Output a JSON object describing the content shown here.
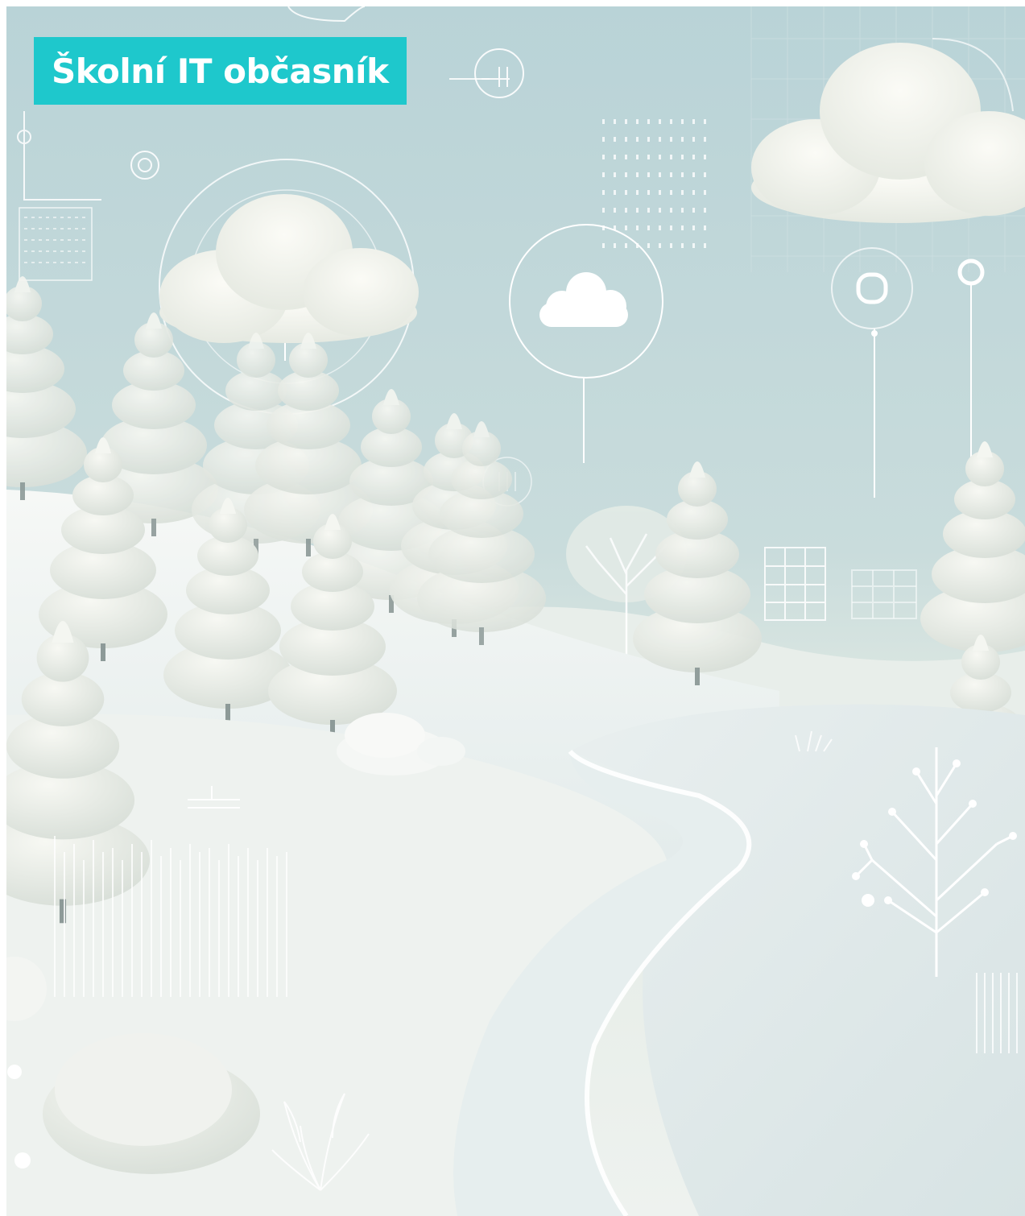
{
  "header": {
    "title": "Školní IT občasník"
  },
  "colors": {
    "title_background": "#1ec8cc",
    "title_text": "#ffffff",
    "sky_top": "#b7d2d6",
    "sky_bottom": "#dde8e2",
    "snow": "#f2f5f3",
    "snow_shadow": "#d4e0e0"
  },
  "scene": {
    "depicts": [
      "winter-landscape",
      "snowy-hills",
      "snow-covered-trees",
      "winding-path",
      "clouds",
      "tech-circle-icons",
      "grid-panels"
    ]
  }
}
